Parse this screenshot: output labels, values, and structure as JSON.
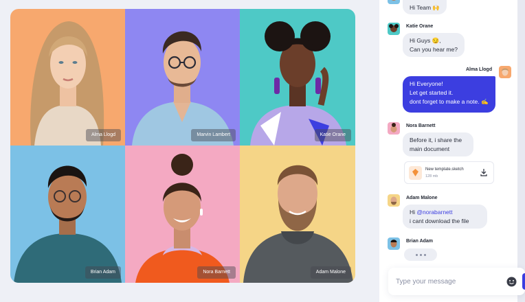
{
  "participants": [
    {
      "name": "Alma Llogd",
      "bg": "#f7a86e"
    },
    {
      "name": "Marvin Lambert",
      "bg": "#8e87f2"
    },
    {
      "name": "Katie Orane",
      "bg": "#4ec9c6"
    },
    {
      "name": "Brian Adam",
      "bg": "#7cc1e6"
    },
    {
      "name": "Nora Barnett",
      "bg": "#f4a9c2"
    },
    {
      "name": "Adam Malone",
      "bg": "#f5d587"
    }
  ],
  "chat": {
    "messages": [
      {
        "sender": "",
        "lines": [
          "Hi Team 🙌"
        ]
      },
      {
        "sender": "Katie Orane",
        "lines": [
          "Hi Guys 😏,",
          "Can you hear me?"
        ]
      },
      {
        "sender": "Alma Llogd",
        "lines": [
          "Hi Everyone!",
          "Let get started it.",
          "dont forget to make a note. ✍"
        ]
      },
      {
        "sender": "Nora Barnett",
        "lines": [
          "Before it, i share the",
          "main document"
        ]
      },
      {
        "sender": "Adam Malone",
        "mention": "@norabarnett",
        "lines": [
          "Hi",
          "i cant download the file"
        ]
      },
      {
        "sender": "Brian Adam",
        "lines": []
      }
    ],
    "attachment": {
      "name": "New template.sketch",
      "size": "128 mb"
    },
    "composer_placeholder": "Type your message"
  },
  "colors": {
    "accent": "#3c3ee0",
    "bubble": "#eceef4"
  },
  "icons": [
    "download-icon",
    "emoji-icon",
    "file-icon",
    "send-icon"
  ]
}
